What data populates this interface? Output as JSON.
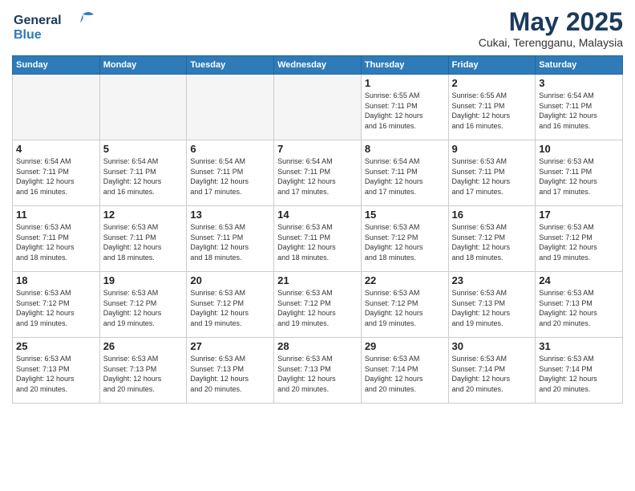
{
  "logo": {
    "line1": "General",
    "line2": "Blue"
  },
  "title": "May 2025",
  "subtitle": "Cukai, Terengganu, Malaysia",
  "days_header": [
    "Sunday",
    "Monday",
    "Tuesday",
    "Wednesday",
    "Thursday",
    "Friday",
    "Saturday"
  ],
  "weeks": [
    [
      {
        "day": "",
        "info": ""
      },
      {
        "day": "",
        "info": ""
      },
      {
        "day": "",
        "info": ""
      },
      {
        "day": "",
        "info": ""
      },
      {
        "day": "1",
        "info": "Sunrise: 6:55 AM\nSunset: 7:11 PM\nDaylight: 12 hours\nand 16 minutes."
      },
      {
        "day": "2",
        "info": "Sunrise: 6:55 AM\nSunset: 7:11 PM\nDaylight: 12 hours\nand 16 minutes."
      },
      {
        "day": "3",
        "info": "Sunrise: 6:54 AM\nSunset: 7:11 PM\nDaylight: 12 hours\nand 16 minutes."
      }
    ],
    [
      {
        "day": "4",
        "info": "Sunrise: 6:54 AM\nSunset: 7:11 PM\nDaylight: 12 hours\nand 16 minutes."
      },
      {
        "day": "5",
        "info": "Sunrise: 6:54 AM\nSunset: 7:11 PM\nDaylight: 12 hours\nand 16 minutes."
      },
      {
        "day": "6",
        "info": "Sunrise: 6:54 AM\nSunset: 7:11 PM\nDaylight: 12 hours\nand 17 minutes."
      },
      {
        "day": "7",
        "info": "Sunrise: 6:54 AM\nSunset: 7:11 PM\nDaylight: 12 hours\nand 17 minutes."
      },
      {
        "day": "8",
        "info": "Sunrise: 6:54 AM\nSunset: 7:11 PM\nDaylight: 12 hours\nand 17 minutes."
      },
      {
        "day": "9",
        "info": "Sunrise: 6:53 AM\nSunset: 7:11 PM\nDaylight: 12 hours\nand 17 minutes."
      },
      {
        "day": "10",
        "info": "Sunrise: 6:53 AM\nSunset: 7:11 PM\nDaylight: 12 hours\nand 17 minutes."
      }
    ],
    [
      {
        "day": "11",
        "info": "Sunrise: 6:53 AM\nSunset: 7:11 PM\nDaylight: 12 hours\nand 18 minutes."
      },
      {
        "day": "12",
        "info": "Sunrise: 6:53 AM\nSunset: 7:11 PM\nDaylight: 12 hours\nand 18 minutes."
      },
      {
        "day": "13",
        "info": "Sunrise: 6:53 AM\nSunset: 7:11 PM\nDaylight: 12 hours\nand 18 minutes."
      },
      {
        "day": "14",
        "info": "Sunrise: 6:53 AM\nSunset: 7:11 PM\nDaylight: 12 hours\nand 18 minutes."
      },
      {
        "day": "15",
        "info": "Sunrise: 6:53 AM\nSunset: 7:12 PM\nDaylight: 12 hours\nand 18 minutes."
      },
      {
        "day": "16",
        "info": "Sunrise: 6:53 AM\nSunset: 7:12 PM\nDaylight: 12 hours\nand 18 minutes."
      },
      {
        "day": "17",
        "info": "Sunrise: 6:53 AM\nSunset: 7:12 PM\nDaylight: 12 hours\nand 19 minutes."
      }
    ],
    [
      {
        "day": "18",
        "info": "Sunrise: 6:53 AM\nSunset: 7:12 PM\nDaylight: 12 hours\nand 19 minutes."
      },
      {
        "day": "19",
        "info": "Sunrise: 6:53 AM\nSunset: 7:12 PM\nDaylight: 12 hours\nand 19 minutes."
      },
      {
        "day": "20",
        "info": "Sunrise: 6:53 AM\nSunset: 7:12 PM\nDaylight: 12 hours\nand 19 minutes."
      },
      {
        "day": "21",
        "info": "Sunrise: 6:53 AM\nSunset: 7:12 PM\nDaylight: 12 hours\nand 19 minutes."
      },
      {
        "day": "22",
        "info": "Sunrise: 6:53 AM\nSunset: 7:12 PM\nDaylight: 12 hours\nand 19 minutes."
      },
      {
        "day": "23",
        "info": "Sunrise: 6:53 AM\nSunset: 7:13 PM\nDaylight: 12 hours\nand 19 minutes."
      },
      {
        "day": "24",
        "info": "Sunrise: 6:53 AM\nSunset: 7:13 PM\nDaylight: 12 hours\nand 20 minutes."
      }
    ],
    [
      {
        "day": "25",
        "info": "Sunrise: 6:53 AM\nSunset: 7:13 PM\nDaylight: 12 hours\nand 20 minutes."
      },
      {
        "day": "26",
        "info": "Sunrise: 6:53 AM\nSunset: 7:13 PM\nDaylight: 12 hours\nand 20 minutes."
      },
      {
        "day": "27",
        "info": "Sunrise: 6:53 AM\nSunset: 7:13 PM\nDaylight: 12 hours\nand 20 minutes."
      },
      {
        "day": "28",
        "info": "Sunrise: 6:53 AM\nSunset: 7:13 PM\nDaylight: 12 hours\nand 20 minutes."
      },
      {
        "day": "29",
        "info": "Sunrise: 6:53 AM\nSunset: 7:14 PM\nDaylight: 12 hours\nand 20 minutes."
      },
      {
        "day": "30",
        "info": "Sunrise: 6:53 AM\nSunset: 7:14 PM\nDaylight: 12 hours\nand 20 minutes."
      },
      {
        "day": "31",
        "info": "Sunrise: 6:53 AM\nSunset: 7:14 PM\nDaylight: 12 hours\nand 20 minutes."
      }
    ]
  ]
}
